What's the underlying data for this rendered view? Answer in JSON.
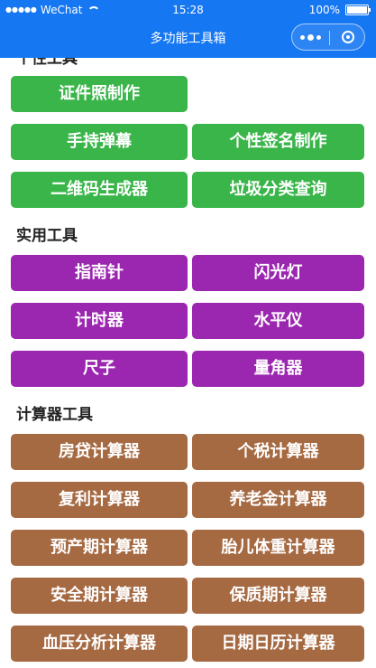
{
  "status_bar": {
    "carrier": "WeChat",
    "time": "15:28",
    "battery": "100%"
  },
  "nav": {
    "title": "多功能工具箱"
  },
  "sections": {
    "personal": {
      "title": "个性工具",
      "buttons": [
        "证件照制作",
        "手持弹幕",
        "个性签名制作",
        "二维码生成器",
        "垃圾分类查询"
      ]
    },
    "practical": {
      "title": "实用工具",
      "buttons": [
        "指南针",
        "闪光灯",
        "计时器",
        "水平仪",
        "尺子",
        "量角器"
      ]
    },
    "calculators": {
      "title": "计算器工具",
      "buttons": [
        "房贷计算器",
        "个税计算器",
        "复利计算器",
        "养老金计算器",
        "预产期计算器",
        "胎儿体重计算器",
        "安全期计算器",
        "保质期计算器",
        "血压分析计算器",
        "日期日历计算器"
      ]
    }
  },
  "colors": {
    "nav_bg": "#1677f2",
    "green": "#3ab54a",
    "purple": "#9b27b0",
    "brown": "#a66a43"
  }
}
